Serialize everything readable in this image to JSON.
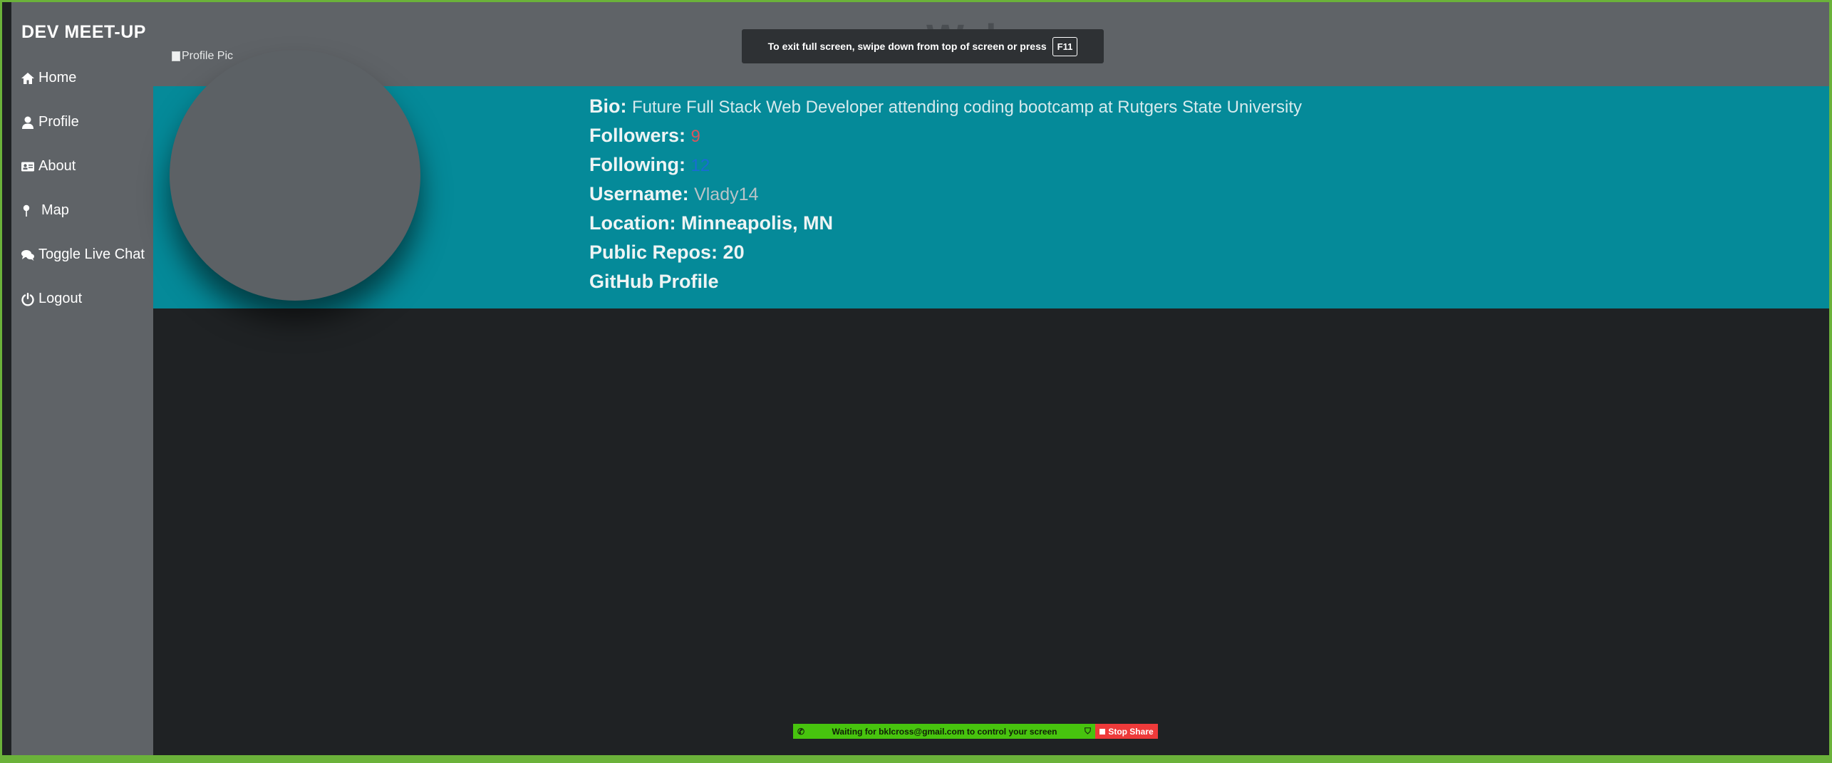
{
  "sidebar": {
    "brand": "DEV MEET-UP",
    "items": [
      {
        "label": "Home",
        "icon": "home-icon"
      },
      {
        "label": "Profile",
        "icon": "user-icon"
      },
      {
        "label": "About",
        "icon": "id-card-icon"
      },
      {
        "label": "Map",
        "icon": "map-pin-icon"
      },
      {
        "label": "Toggle Live Chat",
        "icon": "chat-icon"
      },
      {
        "label": "Logout",
        "icon": "power-icon"
      }
    ]
  },
  "header": {
    "title": "Welcom",
    "fullscreen_notice": "To exit full screen, swipe down from top of screen or press",
    "fullscreen_key": "F11"
  },
  "profile": {
    "image_alt": "Profile Pic",
    "bio_label": "Bio:",
    "bio": "Future Full Stack Web Developer attending coding bootcamp at Rutgers State University",
    "followers_label": "Followers:",
    "followers": "9",
    "following_label": "Following:",
    "following": "12",
    "username_label": "Username:",
    "username": "Vlady14",
    "location_label": "Location:",
    "location": "Minneapolis, MN",
    "repos_label": "Public Repos:",
    "repos": "20",
    "github_link": "GitHub Profile"
  },
  "screen_share": {
    "message": "Waiting for bklcross@gmail.com to control your screen",
    "stop_label": "Stop Share"
  },
  "colors": {
    "sidebar": "#5f6367",
    "band": "#058a99",
    "background": "#1f2224",
    "share_green": "#47c40e",
    "stop_red": "#ee3a3a"
  }
}
